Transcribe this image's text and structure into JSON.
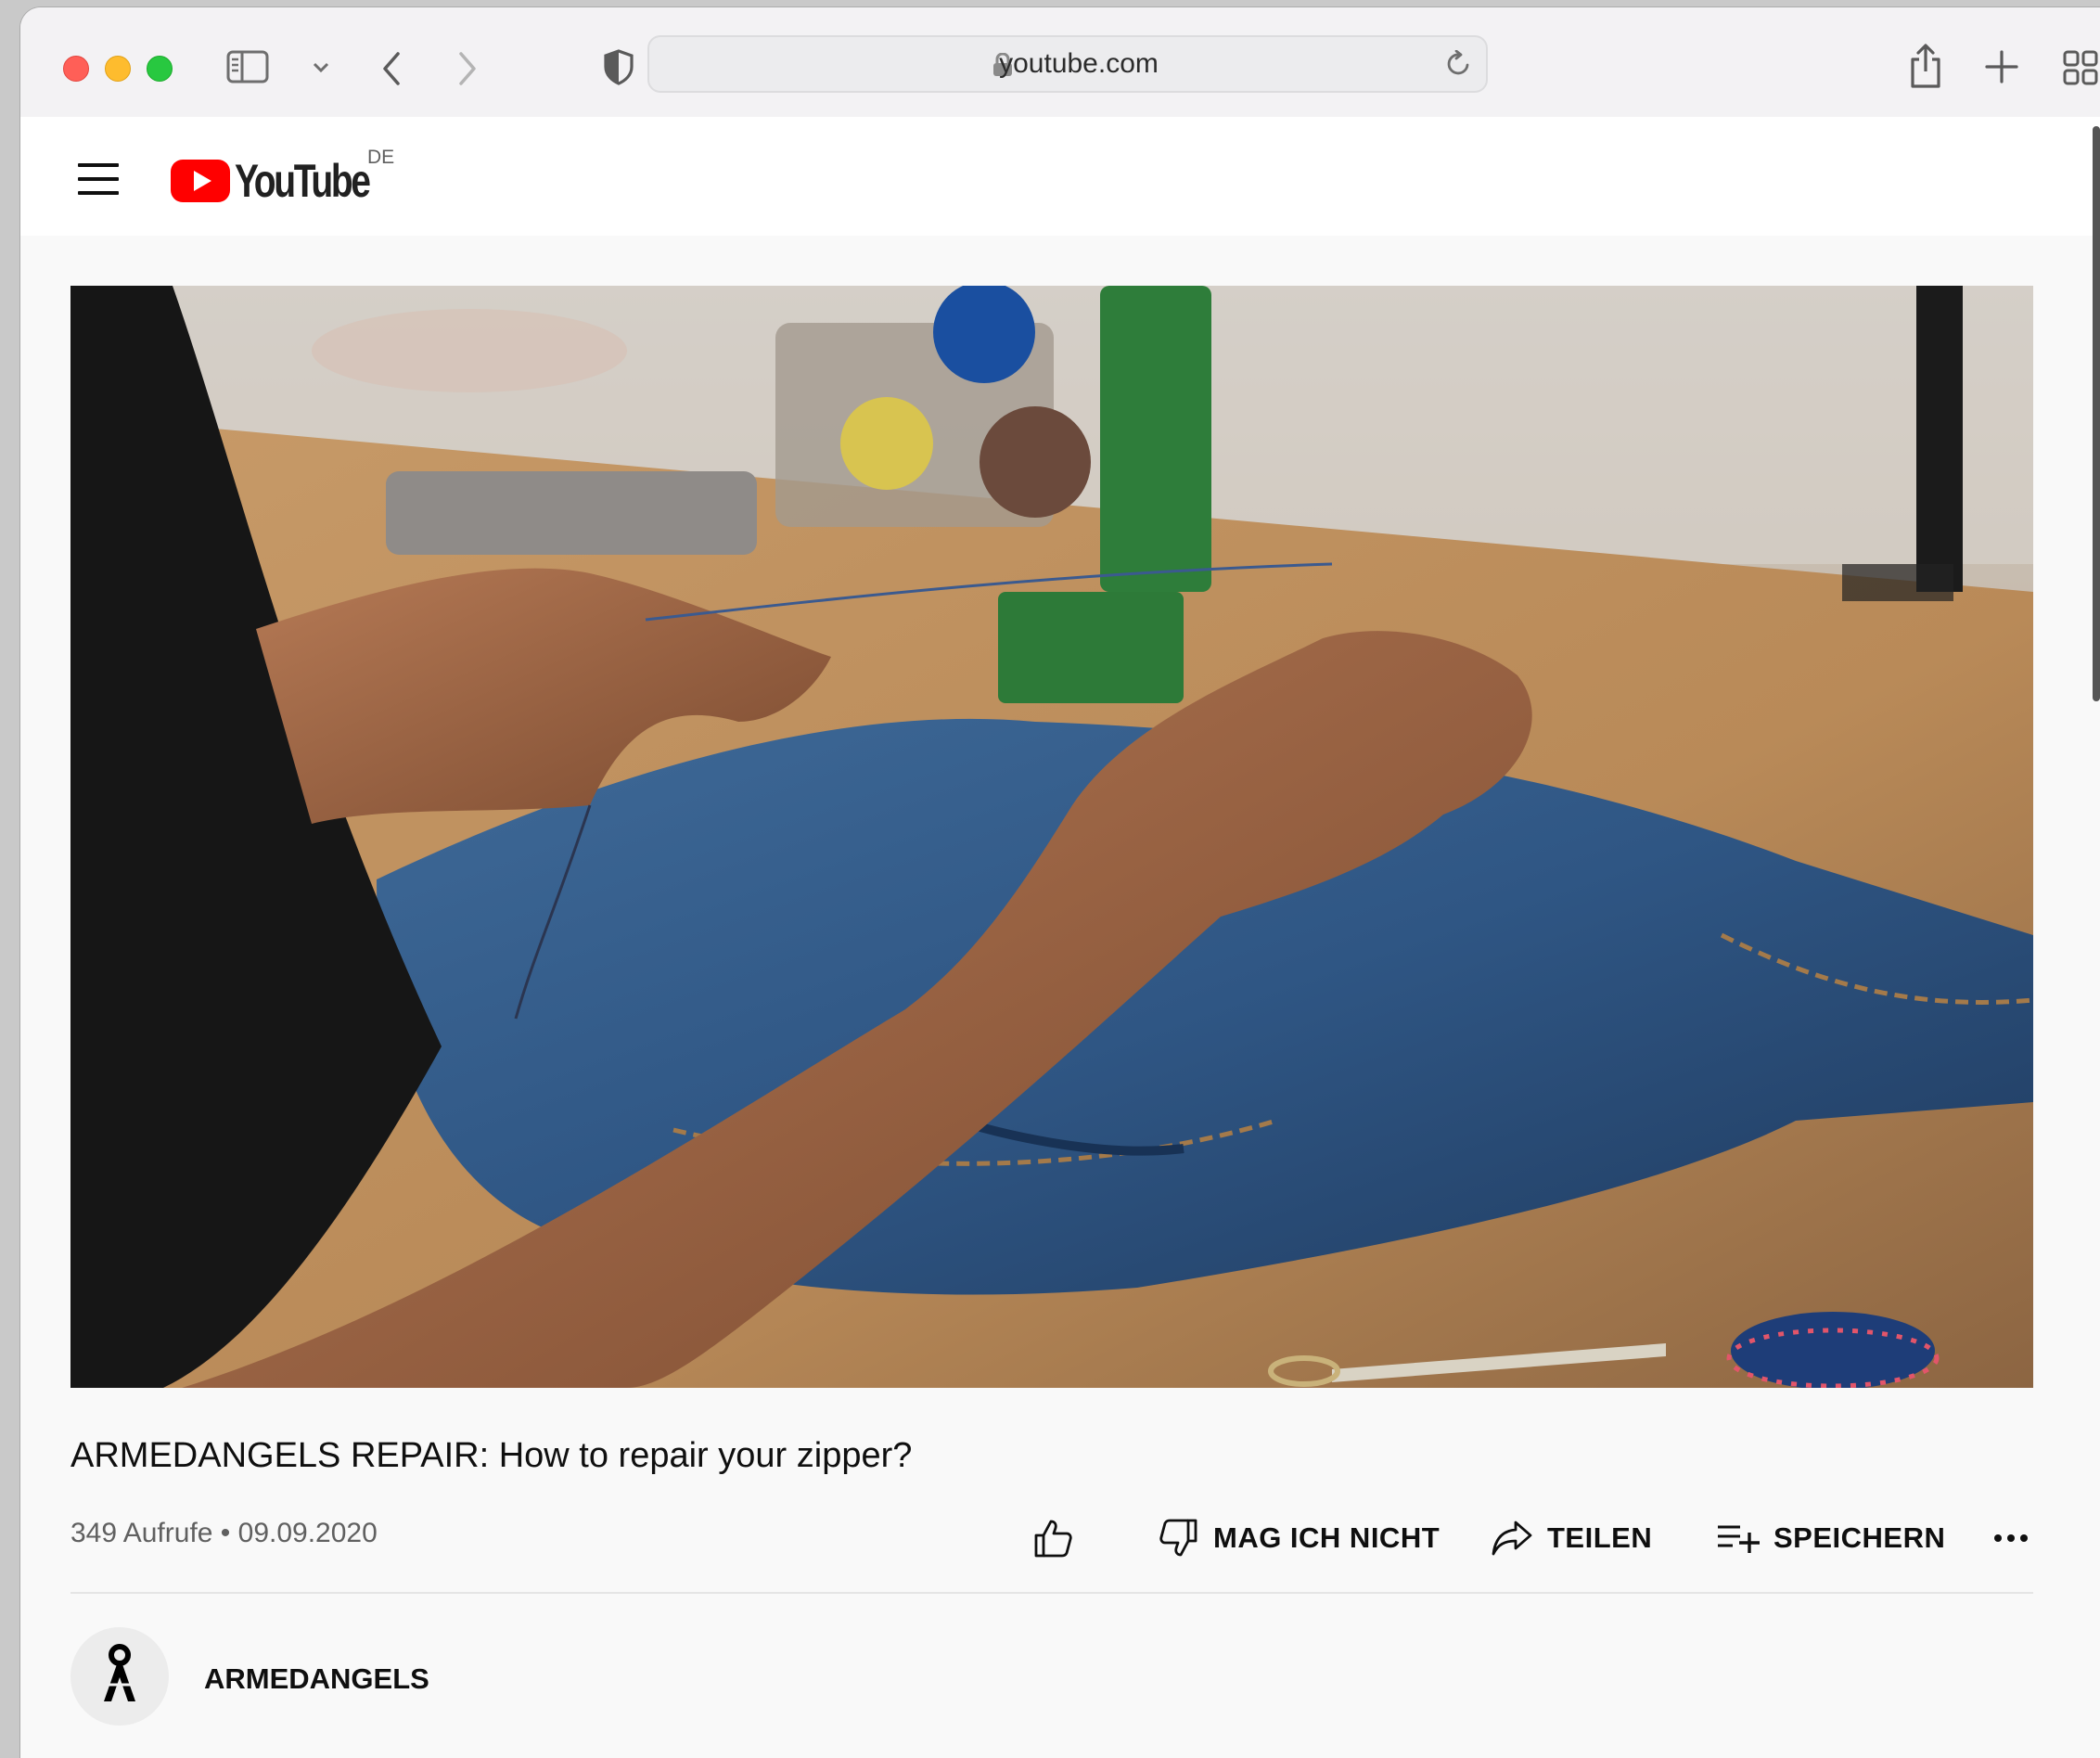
{
  "browser": {
    "url": "youtube.com"
  },
  "youtube": {
    "region": "DE",
    "logo_text": "YouTube"
  },
  "video": {
    "title": "ARMEDANGELS REPAIR: How to repair your zipper?",
    "meta": "349 Aufrufe • 09.09.2020",
    "actions": {
      "dislike_label": "MAG ICH NICHT",
      "share_label": "TEILEN",
      "save_label": "SPEICHERN"
    }
  },
  "channel": {
    "name": "ARMEDANGELS"
  },
  "colors": {
    "brand_red": "#ff0000",
    "text_primary": "#0f0f0f",
    "text_secondary": "#606060"
  }
}
